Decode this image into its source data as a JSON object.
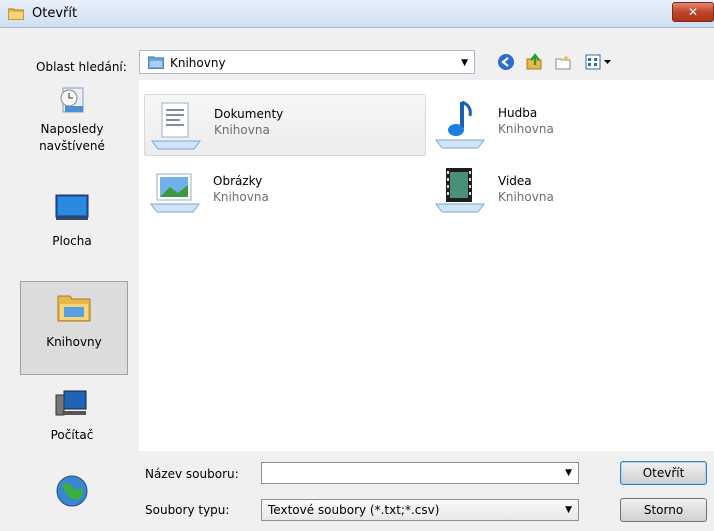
{
  "window": {
    "title": "Otevřít",
    "close": "✕"
  },
  "lookin": {
    "label": "Oblast hledání:",
    "value": "Knihovny"
  },
  "places": [
    {
      "label": "Naposledy\nnavštívené"
    },
    {
      "label": "Plocha"
    },
    {
      "label": "Knihovny"
    },
    {
      "label": "Počítač"
    }
  ],
  "items": [
    {
      "name": "Dokumenty",
      "sub": "Knihovna"
    },
    {
      "name": "Hudba",
      "sub": "Knihovna"
    },
    {
      "name": "Obrázky",
      "sub": "Knihovna"
    },
    {
      "name": "Videa",
      "sub": "Knihovna"
    }
  ],
  "filename": {
    "label": "Název souboru:",
    "value": ""
  },
  "filetype": {
    "label": "Soubory typu:",
    "value": "Textové soubory (*.txt;*.csv)"
  },
  "buttons": {
    "open": "Otevřít",
    "cancel": "Storno"
  }
}
